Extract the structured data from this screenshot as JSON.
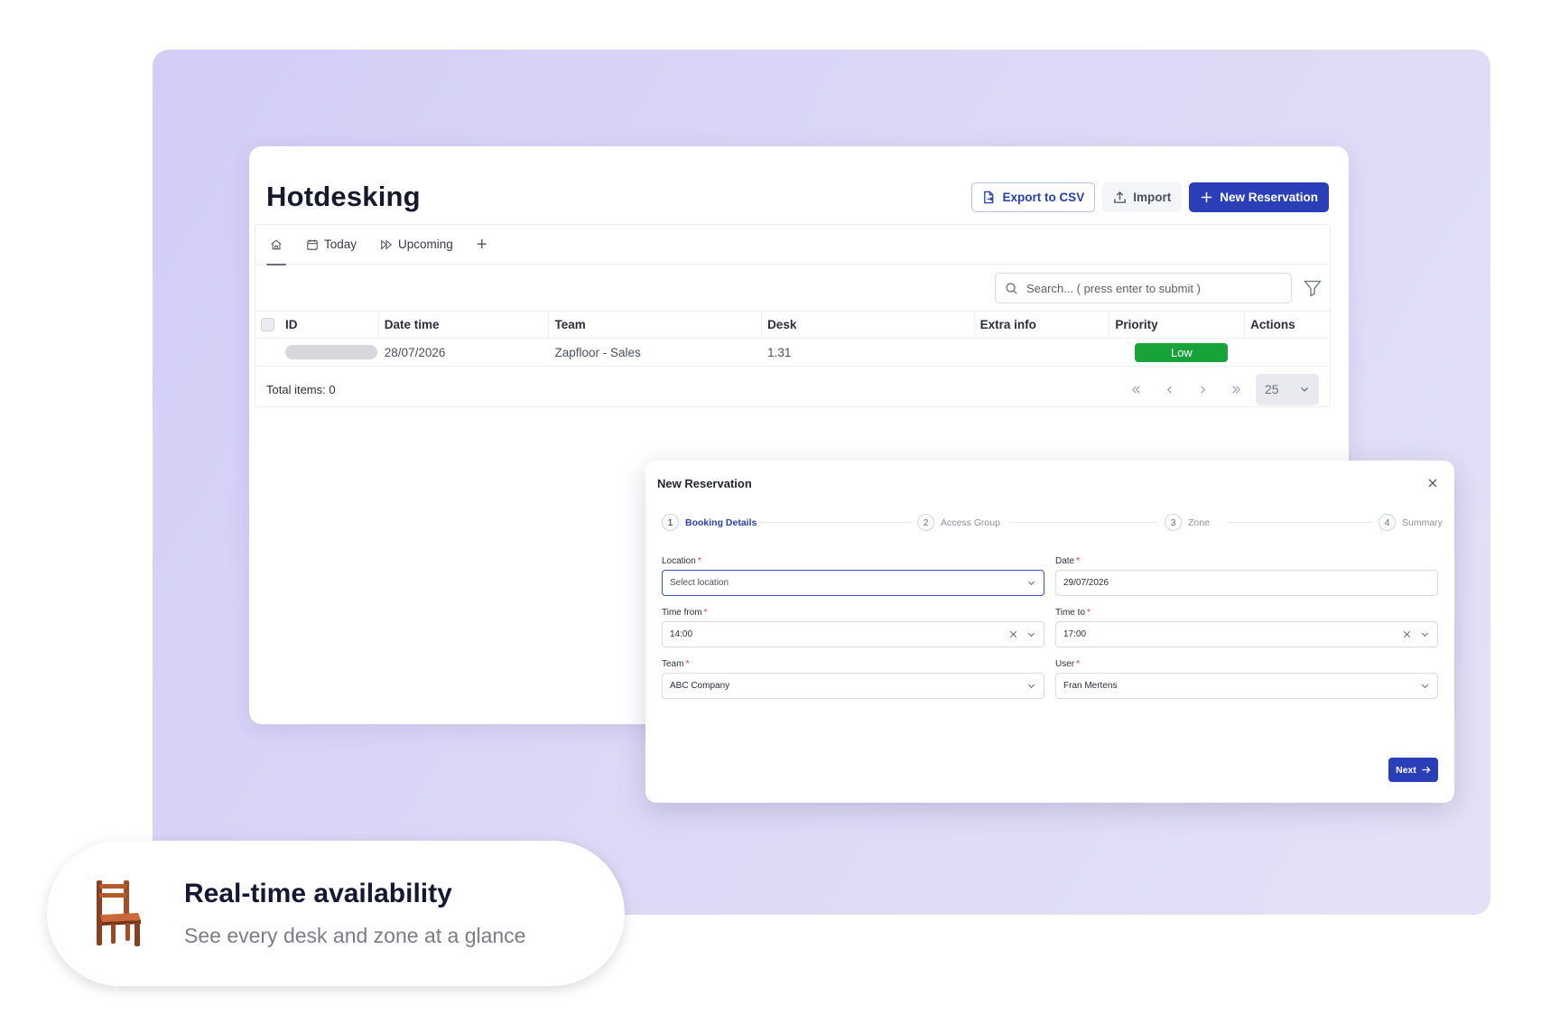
{
  "app": {
    "title": "Hotdesking",
    "toolbar": {
      "export_label": "Export to CSV",
      "import_label": "Import",
      "new_label": "New Reservation"
    },
    "tabs": [
      {
        "label": "",
        "icon": "home-icon"
      },
      {
        "label": "Today",
        "icon": "calendar-icon"
      },
      {
        "label": "Upcoming",
        "icon": "fast-forward-icon"
      }
    ],
    "search": {
      "placeholder": "Search... ( press enter to submit )",
      "value": ""
    },
    "table": {
      "columns": [
        "ID",
        "Date time",
        "Team",
        "Desk",
        "Extra info",
        "Priority",
        "Actions"
      ],
      "rows": [
        {
          "id": "",
          "datetime": "28/07/2026",
          "team": "Zapfloor - Sales",
          "desk": "1.31",
          "extra": "",
          "priority": "Low"
        }
      ]
    },
    "footer": {
      "total": "Total items: 0",
      "page_size": "25"
    }
  },
  "modal": {
    "title": "New Reservation",
    "steps": [
      {
        "num": "1",
        "label": "Booking Details"
      },
      {
        "num": "2",
        "label": "Access Group"
      },
      {
        "num": "3",
        "label": "Zone"
      },
      {
        "num": "4",
        "label": "Summary"
      }
    ],
    "fields": {
      "location": {
        "label": "Location",
        "value": "Select location"
      },
      "date": {
        "label": "Date",
        "value": "29/07/2026"
      },
      "time_from": {
        "label": "Time from",
        "value": "14:00"
      },
      "time_to": {
        "label": "Time to",
        "value": "17:00"
      },
      "team": {
        "label": "Team",
        "value": "ABC Company"
      },
      "user": {
        "label": "User",
        "value": "Fran Mertens"
      }
    },
    "next_label": "Next"
  },
  "feature": {
    "title": "Real-time availability",
    "subtitle": "See every desk and zone at a glance",
    "icon": "chair-icon"
  },
  "colors": {
    "primary": "#2a3eb8",
    "priority_low": "#18a33a",
    "background": "#d8d3f7"
  }
}
